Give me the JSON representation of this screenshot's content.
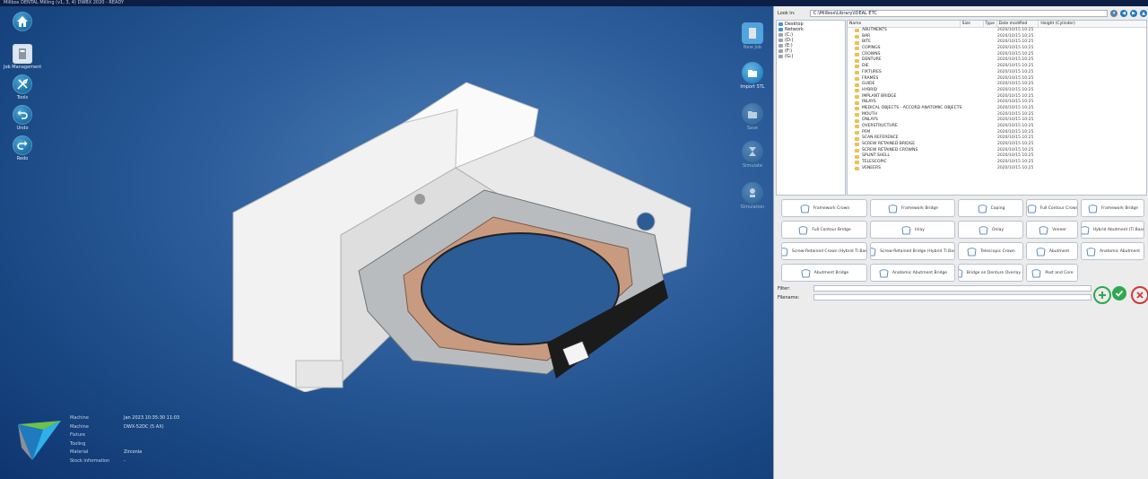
{
  "window": {
    "title": "Millbox  DENTAL Milling (v1, 3, 4)  DWBX 2020 - READY"
  },
  "left_toolbar": [
    {
      "label": "",
      "icon": "home-icon"
    },
    {
      "label": "Job Management",
      "icon": "job-management-icon"
    },
    {
      "label": "Tools",
      "icon": "tools-icon"
    },
    {
      "label": "Undo",
      "icon": "undo-icon"
    },
    {
      "label": "Redo",
      "icon": "redo-icon"
    }
  ],
  "right_toolbar": [
    {
      "label": "New Job",
      "icon": "new-job-icon"
    },
    {
      "label": "Import STL",
      "icon": "import-stl-icon"
    },
    {
      "label": "Save",
      "icon": "save-icon"
    },
    {
      "label": "Simulate",
      "icon": "simulate-icon"
    },
    {
      "label": "Simulation",
      "icon": "simulation-icon"
    }
  ],
  "machine_info": [
    {
      "key": "Machine",
      "value": "Jan 2023 10:35:30 11:03"
    },
    {
      "key": "Machine",
      "value": "DWX-52DC (5 AX)"
    },
    {
      "key": "Fixture",
      "value": ""
    },
    {
      "key": "Tooling",
      "value": ""
    },
    {
      "key": "Material",
      "value": "Zirconia"
    },
    {
      "key": "Stock information",
      "value": "-"
    }
  ],
  "file_browser": {
    "address_label": "Look in:",
    "address_value": "C:\\Millbox\\Library\\IDEAL ETC",
    "tree": [
      "Desktop",
      "Network",
      "(C:)",
      "(D:)",
      "(E:)",
      "(F:)",
      "(G:)"
    ],
    "columns": [
      "Name",
      "Size",
      "Type",
      "Date modified",
      "Height (Cylinder)"
    ],
    "files": [
      {
        "name": "ABUTMENTS",
        "date": "2020/10/15 10:25"
      },
      {
        "name": "BAR",
        "date": "2020/10/15 10:25"
      },
      {
        "name": "BITE",
        "date": "2020/10/15 10:25"
      },
      {
        "name": "COPINGS",
        "date": "2020/10/15 10:25"
      },
      {
        "name": "CROWNS",
        "date": "2020/10/15 10:25"
      },
      {
        "name": "DENTURE",
        "date": "2020/10/15 10:25"
      },
      {
        "name": "DIE",
        "date": "2020/10/15 10:25"
      },
      {
        "name": "FIXTURES",
        "date": "2020/10/15 10:25"
      },
      {
        "name": "FRAMES",
        "date": "2020/10/15 10:25"
      },
      {
        "name": "GUIDE",
        "date": "2020/10/15 10:25"
      },
      {
        "name": "HYBRID",
        "date": "2020/10/15 10:25"
      },
      {
        "name": "IMPLANT BRIDGE",
        "date": "2020/10/15 10:25"
      },
      {
        "name": "INLAYS",
        "date": "2020/10/15 10:25"
      },
      {
        "name": "MEDICAL OBJECTS - ACCORD ANATOMIC OBJECTS",
        "date": "2020/10/15 10:25"
      },
      {
        "name": "MOUTH",
        "date": "2020/10/15 10:25"
      },
      {
        "name": "ONLAYS",
        "date": "2020/10/15 10:25"
      },
      {
        "name": "OVERSTRUCTURE",
        "date": "2020/10/15 10:25"
      },
      {
        "name": "PFM",
        "date": "2020/10/15 10:25"
      },
      {
        "name": "SCAN REFERENCE",
        "date": "2020/10/15 10:25"
      },
      {
        "name": "SCREW RETAINED BRIDGE",
        "date": "2020/10/15 10:25"
      },
      {
        "name": "SCREW RETAINED CROWNS",
        "date": "2020/10/15 10:25"
      },
      {
        "name": "SPLINT SHELL",
        "date": "2020/10/15 10:25"
      },
      {
        "name": "TELESCOPIC",
        "date": "2020/10/15 10:25"
      },
      {
        "name": "VENEERS",
        "date": "2020/10/15 10:25"
      }
    ]
  },
  "template_buttons": [
    {
      "label": "Framework Crown",
      "icon": "framework-crown-icon"
    },
    {
      "label": "Framework Bridge",
      "icon": "framework-bridge-icon"
    },
    {
      "label": "Coping",
      "icon": "coping-icon"
    },
    {
      "label": "Full Contour Crown",
      "icon": "full-contour-crown-icon"
    },
    {
      "label": "Framework Bridge",
      "icon": "framework-bridge-2-icon"
    },
    {
      "label": "Full Contour Bridge",
      "icon": "full-contour-bridge-icon"
    },
    {
      "label": "Inlay",
      "icon": "inlay-icon"
    },
    {
      "label": "Onlay",
      "icon": "onlay-icon"
    },
    {
      "label": "Veneer",
      "icon": "veneer-icon"
    },
    {
      "label": "Hybrid Abutment (Ti Base)",
      "icon": "hybrid-abutment-icon"
    },
    {
      "label": "Screw-Retained Crown (Hybrid Ti Base)",
      "icon": "screw-retained-crown-icon"
    },
    {
      "label": "Screw-Retained Bridge (Hybrid Ti Base)",
      "icon": "screw-retained-bridge-icon"
    },
    {
      "label": "Telescopic Crown",
      "icon": "telescopic-crown-icon"
    },
    {
      "label": "Abutment",
      "icon": "abutment-icon"
    },
    {
      "label": "Anatomic Abutment",
      "icon": "anatomic-abutment-icon"
    },
    {
      "label": "Abutment Bridge",
      "icon": "abutment-bridge-icon"
    },
    {
      "label": "Anatomic Abutment Bridge",
      "icon": "anatomic-abutment-bridge-icon"
    },
    {
      "label": "Bridge on Denture Overlay Bar",
      "icon": "bridge-overlay-icon"
    },
    {
      "label": "Post and Core",
      "icon": "post-and-core-icon"
    }
  ],
  "meta": {
    "filter_label": "Filter:",
    "filename_label": "Filename:"
  },
  "actions": [
    {
      "name": "add",
      "color": "#2fa84f"
    },
    {
      "name": "confirm",
      "color": "#2fa84f"
    },
    {
      "name": "cancel",
      "color": "#d23a3a"
    }
  ],
  "colors": {
    "viewport_bg": "#2d5e9b",
    "panel_bg": "#ececec",
    "accent": "#1f7ac0",
    "folder": "#e8c15a"
  }
}
